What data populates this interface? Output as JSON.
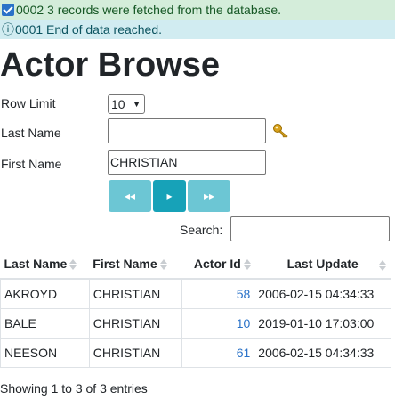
{
  "messages": {
    "success": "0002 3 records were fetched from the database.",
    "info_glyph": "ⓘ",
    "info": "0001 End of data reached."
  },
  "page": {
    "title": "Actor Browse"
  },
  "form": {
    "row_limit_label": "Row Limit",
    "row_limit_value": "10",
    "last_name_label": "Last Name",
    "last_name_value": "",
    "first_name_label": "First Name",
    "first_name_value": "CHRISTIAN",
    "lookup_icon": "key-icon"
  },
  "pager": {
    "first_label": "◂◂",
    "next_label": "▸",
    "last_label": "▸▸",
    "first_disabled": true,
    "next_disabled": false,
    "last_disabled": true
  },
  "search": {
    "label": "Search:",
    "value": ""
  },
  "table": {
    "columns": [
      "Last Name",
      "First Name",
      "Actor Id",
      "Last Update"
    ],
    "rows": [
      [
        "AKROYD",
        "CHRISTIAN",
        "58",
        "2006-02-15 04:34:33"
      ],
      [
        "BALE",
        "CHRISTIAN",
        "10",
        "2019-01-10 17:03:00"
      ],
      [
        "NEESON",
        "CHRISTIAN",
        "61",
        "2006-02-15 04:34:33"
      ]
    ]
  },
  "footer": {
    "summary": "Showing 1 to 3 of 3 entries"
  },
  "colors": {
    "success_bg": "#d4edda",
    "info_bg": "#d1ecf1",
    "button": "#17a2b8",
    "link": "#2a72c8"
  }
}
